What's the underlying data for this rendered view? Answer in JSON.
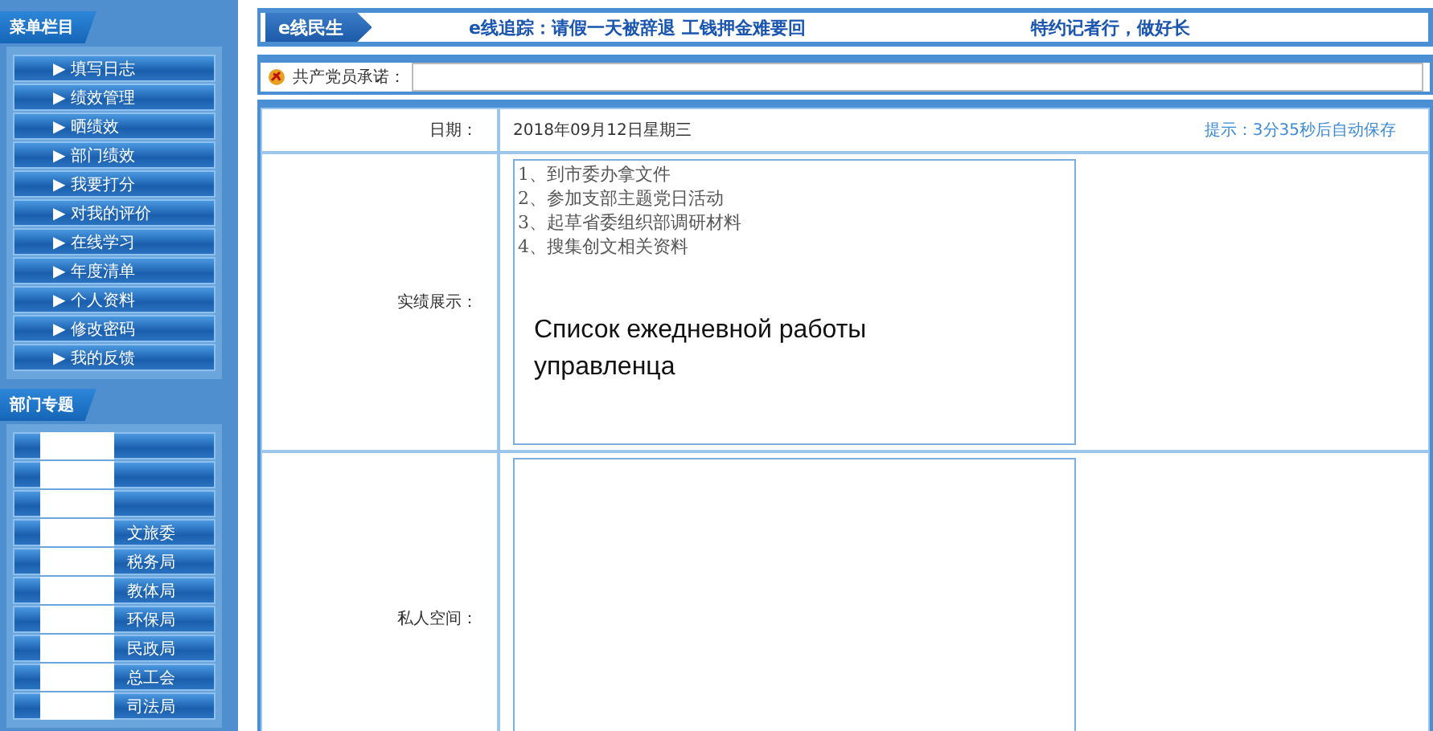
{
  "sidebar": {
    "menu_title": "菜单栏目",
    "menu_items": [
      "填写日志",
      "绩效管理",
      "晒绩效",
      "部门绩效",
      "我要打分",
      "对我的评价",
      "在线学习",
      "年度清单",
      "个人资料",
      "修改密码",
      "我的反馈"
    ],
    "dept_title": "部门专题",
    "dept_items": [
      {
        "kind": "redacted"
      },
      {
        "kind": "redacted"
      },
      {
        "kind": "redacted"
      },
      {
        "kind": "partial",
        "label": "文旅委"
      },
      {
        "kind": "partial",
        "label": "税务局"
      },
      {
        "kind": "partial",
        "label": "教体局"
      },
      {
        "kind": "partial",
        "label": "环保局"
      },
      {
        "kind": "partial",
        "label": "民政局"
      },
      {
        "kind": "partial",
        "label": "总工会"
      },
      {
        "kind": "partial",
        "label": "司法局"
      }
    ],
    "marker": "▶"
  },
  "banner": {
    "badge": "e线民生",
    "headline": "e线追踪：请假一天被辞退 工钱押金难要回",
    "headline_right": "特约记者行，做好长"
  },
  "promise": {
    "label": "共产党员承诺："
  },
  "form": {
    "date_label": "日期：",
    "date": "2018年09月12日星期三",
    "autosave": "提示：3分35秒后自动保存",
    "record_label": "实绩展示：",
    "record_value": "1、到市委办拿文件\n2、参加支部主题党日活动\n3、起草省委组织部调研材料\n4、搜集创文相关资料",
    "caption": "Список ежедневной работы управленца",
    "private_label": "私人空间："
  }
}
